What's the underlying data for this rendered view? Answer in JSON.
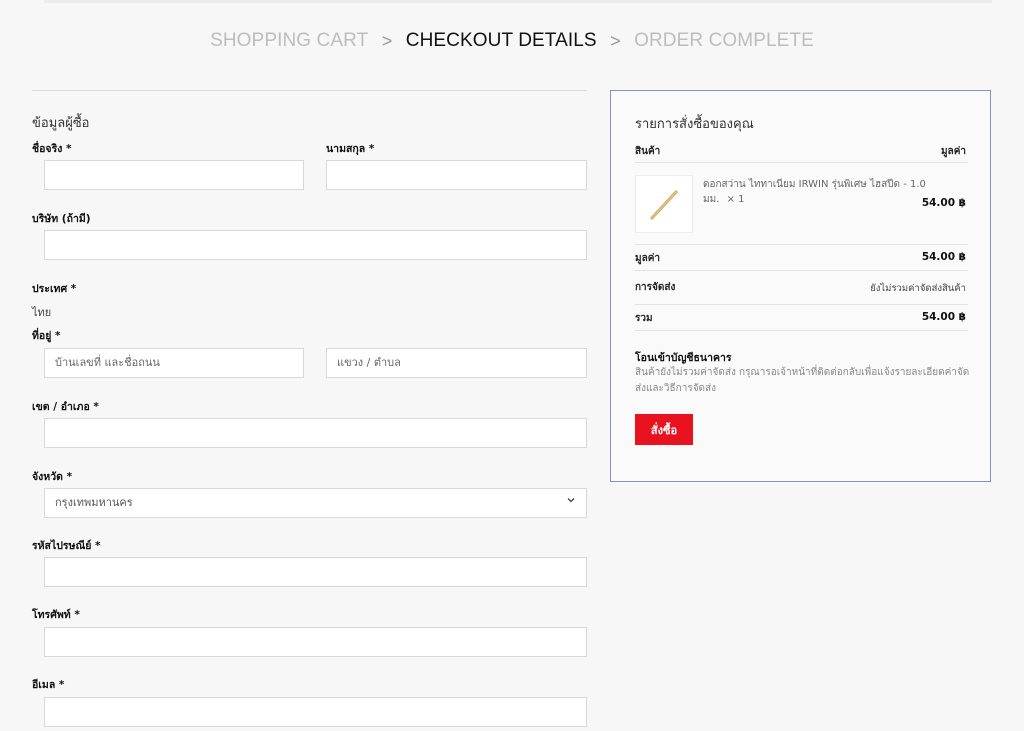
{
  "steps": {
    "cart": "SHOPPING CART",
    "details": "CHECKOUT DETAILS",
    "complete": "ORDER COMPLETE",
    "separator": ">"
  },
  "billing": {
    "title": "ข้อมูลผู้ซื้อ",
    "first_name_label": "ชื่อจริง *",
    "first_name_value": "",
    "last_name_label": "นามสกุล *",
    "last_name_value": "",
    "company_label": "บริษัท (ถ้ามี)",
    "company_value": "",
    "country_label": "ประเทศ *",
    "country_value": "ไทย",
    "address_label": "ที่อยู่ *",
    "address_placeholder": "บ้านเลขที่ และชื่อถนน",
    "subdistrict_placeholder": "แขวง / ตำบล",
    "district_label": "เขต / อำเภอ *",
    "district_value": "",
    "province_label": "จังหวัด *",
    "province_value": "กรุงเทพมหานคร",
    "postcode_label": "รหัสไปรษณีย์ *",
    "postcode_value": "",
    "phone_label": "โทรศัพท์ *",
    "phone_value": "",
    "email_label": "อีเมล *",
    "email_value": ""
  },
  "summary": {
    "title": "รายการสั่งซื้อของคุณ",
    "col_product": "สินค้า",
    "col_total": "มูลค่า",
    "item": {
      "name": "ดอกสว่าน ไททาเนียม IRWIN รุ่นพิเศษ ไฮสปีด - 1.0 มม.",
      "qty": "× 1",
      "price": "54.00 ฿"
    },
    "subtotal_label": "มูลค่า",
    "subtotal_value": "54.00 ฿",
    "shipping_label": "การจัดส่ง",
    "shipping_value": "ยังไม่รวมค่าจัดส่งสินค้า",
    "total_label": "รวม",
    "total_value": "54.00 ฿",
    "payment_title": "โอนเข้าบัญชีธนาคาร",
    "payment_desc": "สินค้ายังไม่รวมค่าจัดส่ง กรุณารอเจ้าหน้าที่ติดต่อกลับเพื่อแจ้งรายละเอียดค่าจัดส่งและวิธีการจัดส่ง",
    "order_button": "สั่งซื้อ"
  },
  "colors": {
    "accent": "#e8131f",
    "summary_border": "#7f93c8"
  },
  "icons": {
    "select_arrow": "chevron-down-icon"
  }
}
